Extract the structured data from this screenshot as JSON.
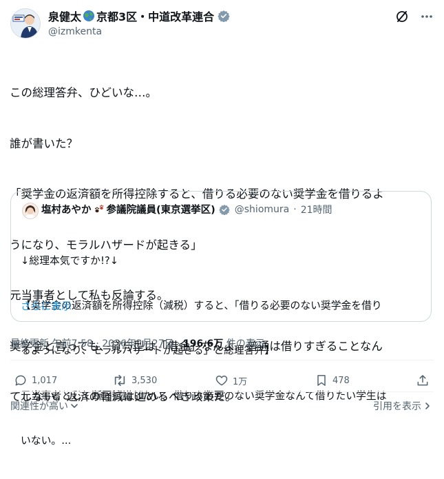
{
  "author": {
    "display_name_part1": "泉健太",
    "display_name_part2": "京都3区・中道改革連合",
    "handle": "@izmkenta",
    "earth_icon": "earth-globe-emoji",
    "verified_icon": "verified-badge-icon",
    "avatar_icon": "author-avatar"
  },
  "top_icons": {
    "grok": "grok-icon",
    "more": "more-options-icon"
  },
  "post": {
    "lines": [
      "この総理答弁、ひどいな…。",
      "誰が書いた？",
      "「奨学金の返済額を所得控除すると、借りる必要のない奨学金を借りるよ",
      "うになり、モラルハザードが起きる」",
      "元当事者として私も反論する。",
      "奨学金と言っても、貸与型は「借金」なんよ。普通は借りすぎることなん",
      "てしない。返済の軽減は進めるべき政策だ。"
    ]
  },
  "quoted": {
    "name_part1": "塩村あやか",
    "name_part2": "参議院議員(東京選挙区)",
    "paw_icon": "paw-prints-emoji",
    "handle": "@shiomura",
    "separator": "·",
    "time": "21時間",
    "lines": [
      "↓総理本気ですか!?↓",
      "【奨学金の返済額を所得控除（減税）すると、「借りる必要のない奨学金を借り",
      "るようになり、モラルハザードが起きる」と総理答弁】",
      "元当事者として断固抗議したい。借りる必要のない奨学金なんて借りたい学生は",
      "いない。..."
    ],
    "show_more": "さらに表示"
  },
  "meta": {
    "label": "最終更新",
    "time": "午前7:58",
    "separator": "·",
    "date": "2026年2月27日",
    "views_value": "196.6万",
    "views_suffix": "件の表示"
  },
  "actions": {
    "replies": "1,017",
    "reposts": "3,530",
    "likes": "1万",
    "bookmarks": "478"
  },
  "footer": {
    "relevance": "関連性が高い",
    "quotes": "引用を表示"
  },
  "colors": {
    "text": "#0f1419",
    "secondary": "#536471",
    "link": "#1d9bf0",
    "verified": "#829aab",
    "border": "#cfd9de"
  }
}
